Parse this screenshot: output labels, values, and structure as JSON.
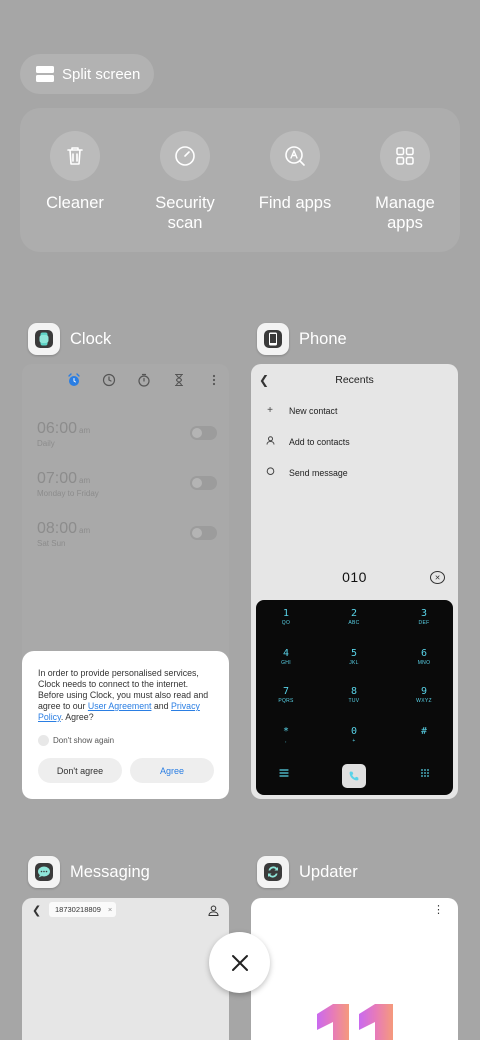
{
  "split_screen": {
    "label": "Split screen"
  },
  "tools": [
    {
      "label": "Cleaner",
      "icon": "trash-icon"
    },
    {
      "label": "Security\nscan",
      "icon": "gauge-icon"
    },
    {
      "label": "Find apps",
      "icon": "search-apps-icon"
    },
    {
      "label": "Manage\napps",
      "icon": "grid-icon"
    }
  ],
  "clock": {
    "name": "Clock",
    "alarms": [
      {
        "time": "06:00",
        "ampm": "am",
        "repeat": "Daily"
      },
      {
        "time": "07:00",
        "ampm": "am",
        "repeat": "Monday to Friday"
      },
      {
        "time": "08:00",
        "ampm": "am",
        "repeat": "Sat Sun"
      }
    ],
    "dialog": {
      "text_1": "In order to provide personalised services, Clock needs to connect to the internet. Before using Clock, you must also read and agree to our ",
      "link_1": "User Agreement",
      "text_2": " and ",
      "link_2": "Privacy Policy",
      "text_3": ". Agree?",
      "dont_show": "Don't show again",
      "disagree": "Don't agree",
      "agree": "Agree"
    }
  },
  "phone": {
    "name": "Phone",
    "title": "Recents",
    "actions": [
      "New contact",
      "Add to contacts",
      "Send message"
    ],
    "dialed": "010",
    "keys": [
      {
        "d": "1",
        "s": "QO"
      },
      {
        "d": "2",
        "s": "ABC"
      },
      {
        "d": "3",
        "s": "DEF"
      },
      {
        "d": "4",
        "s": "GHI"
      },
      {
        "d": "5",
        "s": "JKL"
      },
      {
        "d": "6",
        "s": "MNO"
      },
      {
        "d": "7",
        "s": "PQRS"
      },
      {
        "d": "8",
        "s": "TUV"
      },
      {
        "d": "9",
        "s": "WXYZ"
      },
      {
        "d": "*",
        "s": ","
      },
      {
        "d": "0",
        "s": "+"
      },
      {
        "d": "#",
        "s": ""
      }
    ]
  },
  "messaging": {
    "name": "Messaging",
    "recipient": "18730218809"
  },
  "updater": {
    "name": "Updater"
  },
  "colors": {
    "background": "#a6a6a6",
    "keypad_digit": "#59d3e8",
    "link": "#2a7ee3",
    "alarm_active": "#2a7ee3"
  }
}
